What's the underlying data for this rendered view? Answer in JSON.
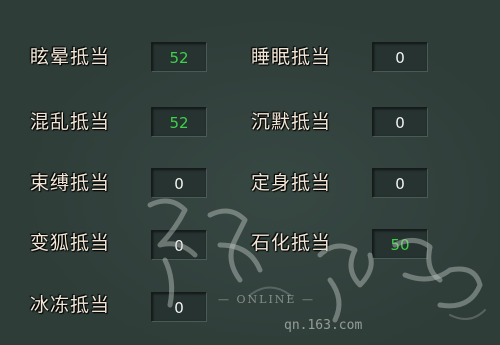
{
  "resist": {
    "left": [
      {
        "label": "眩晕抵当",
        "value": "52",
        "color": "green"
      },
      {
        "label": "混乱抵当",
        "value": "52",
        "color": "green"
      },
      {
        "label": "束缚抵当",
        "value": "0",
        "color": "white"
      },
      {
        "label": "变狐抵当",
        "value": "0",
        "color": "white"
      },
      {
        "label": "冰冻抵当",
        "value": "0",
        "color": "white"
      }
    ],
    "right": [
      {
        "label": "睡眠抵当",
        "value": "0",
        "color": "white"
      },
      {
        "label": "沉默抵当",
        "value": "0",
        "color": "white"
      },
      {
        "label": "定身抵当",
        "value": "0",
        "color": "white"
      },
      {
        "label": "石化抵当",
        "value": "50",
        "color": "green"
      }
    ]
  },
  "watermark": {
    "logo_text": "倩女幽魂",
    "online": "— ONLINE —",
    "url": "qn.163.com"
  },
  "colors": {
    "background": "#2f3d39",
    "label": "#f2e7d6",
    "value_white": "#f4f4f4",
    "value_green": "#3fd14a"
  }
}
